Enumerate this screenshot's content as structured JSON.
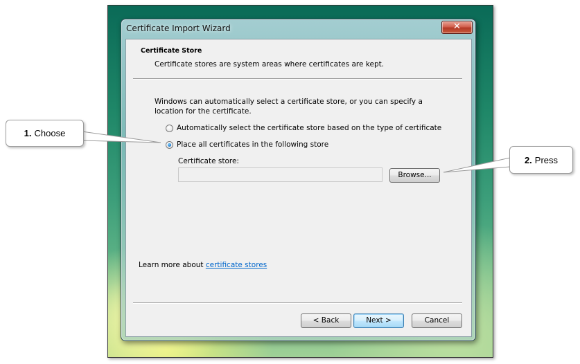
{
  "window": {
    "title": "Certificate Import Wizard",
    "close_label": "✕"
  },
  "header": {
    "title": "Certificate Store",
    "subtitle": "Certificate stores are system areas where certificates are kept."
  },
  "body": {
    "description": "Windows can automatically select a certificate store, or you can specify a location for the certificate.",
    "radio_auto": {
      "label": "Automatically select the certificate store based on the type of certificate",
      "checked": false
    },
    "radio_manual": {
      "label": "Place all certificates in the following store",
      "checked": true
    },
    "store_label": "Certificate store:",
    "store_value": "",
    "browse_label": "Browse...",
    "learn_prefix": "Learn more about ",
    "learn_link": "certificate stores"
  },
  "footer": {
    "back_label": "< Back",
    "next_label": "Next >",
    "cancel_label": "Cancel"
  },
  "callouts": {
    "choose": {
      "number": "1.",
      "text": "Choose"
    },
    "press": {
      "number": "2.",
      "text": "Press"
    }
  }
}
